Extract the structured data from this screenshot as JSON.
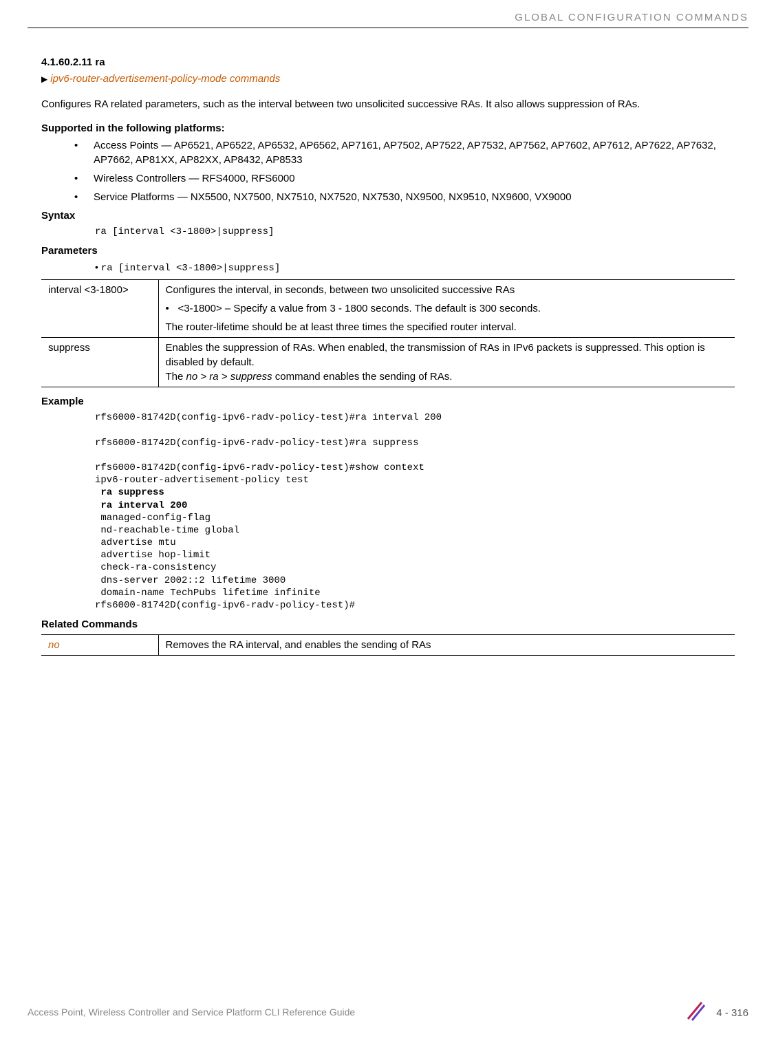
{
  "header": {
    "runningTitle": "GLOBAL CONFIGURATION COMMANDS"
  },
  "section": {
    "number": "4.1.60.2.11",
    "title": "ra",
    "subsectionLink": "ipv6-router-advertisement-policy-mode commands",
    "introPara": "Configures RA related parameters, such as the interval between two unsolicited successive RAs. It also allows suppression of RAs."
  },
  "supported": {
    "heading": "Supported in the following platforms:",
    "items": [
      "Access Points — AP6521, AP6522, AP6532, AP6562, AP7161, AP7502, AP7522, AP7532, AP7562, AP7602, AP7612, AP7622, AP7632, AP7662, AP81XX, AP82XX, AP8432, AP8533",
      "Wireless Controllers — RFS4000, RFS6000",
      "Service Platforms — NX5500, NX7500, NX7510, NX7520, NX7530, NX9500, NX9510, NX9600, VX9000"
    ]
  },
  "syntax": {
    "heading": "Syntax",
    "code": "ra [interval <3-1800>|suppress]"
  },
  "parameters": {
    "heading": "Parameters",
    "bulletCode": "ra [interval <3-1800>|suppress]",
    "rows": [
      {
        "param": "interval <3-1800>",
        "desc1": "Configures the interval, in seconds, between two unsolicited successive RAs",
        "bullet": "<3-1800> – Specify a value from 3 - 1800 seconds. The default is 300 seconds.",
        "desc2": "The router-lifetime should be at least three times the specified router interval."
      },
      {
        "param": "suppress",
        "desc1": "Enables the suppression of RAs. When enabled, the transmission of RAs in IPv6 packets is suppressed. This option is disabled by default.",
        "desc2a": "The ",
        "desc2italic": "no > ra > suppress",
        "desc2b": " command enables the sending of RAs."
      }
    ]
  },
  "example": {
    "heading": "Example",
    "line1": "rfs6000-81742D(config-ipv6-radv-policy-test)#ra interval 200",
    "line2": "rfs6000-81742D(config-ipv6-radv-policy-test)#ra suppress",
    "line3": "rfs6000-81742D(config-ipv6-radv-policy-test)#show context",
    "line4": "ipv6-router-advertisement-policy test",
    "line5": " ra suppress",
    "line6": " ra interval 200",
    "line7": " managed-config-flag",
    "line8": " nd-reachable-time global",
    "line9": " advertise mtu",
    "line10": " advertise hop-limit",
    "line11": " check-ra-consistency",
    "line12": " dns-server 2002::2 lifetime 3000",
    "line13": " domain-name TechPubs lifetime infinite",
    "line14": "rfs6000-81742D(config-ipv6-radv-policy-test)#"
  },
  "related": {
    "heading": "Related Commands",
    "rows": [
      {
        "cmd": "no",
        "desc": "Removes the RA interval, and enables the sending of RAs"
      }
    ]
  },
  "footer": {
    "title": "Access Point, Wireless Controller and Service Platform CLI Reference Guide",
    "pageNum": "4 - 316"
  }
}
